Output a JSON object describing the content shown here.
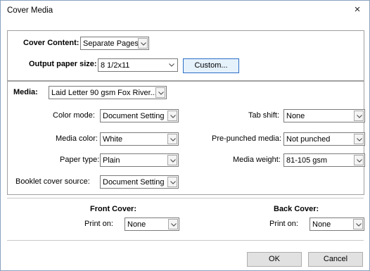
{
  "window": {
    "title": "Cover Media",
    "close_glyph": "×"
  },
  "cover": {
    "content_label": "Cover Content:",
    "content_value": "Separate Pages",
    "output_size_label": "Output paper size:",
    "output_size_value": "8 1/2x11",
    "custom_button": "Custom..."
  },
  "media": {
    "label": "Media:",
    "value": "Laid Letter 90 gsm Fox River...",
    "color_mode_label": "Color mode:",
    "color_mode_value": "Document Setting",
    "media_color_label": "Media color:",
    "media_color_value": "White",
    "paper_type_label": "Paper type:",
    "paper_type_value": "Plain",
    "booklet_label": "Booklet cover source:",
    "booklet_value": "Document Setting",
    "tab_shift_label": "Tab shift:",
    "tab_shift_value": "None",
    "prepunched_label": "Pre-punched media:",
    "prepunched_value": "Not punched",
    "weight_label": "Media weight:",
    "weight_value": "81-105 gsm"
  },
  "front": {
    "heading": "Front Cover:",
    "print_on_label": "Print on:",
    "print_on_value": "None"
  },
  "back": {
    "heading": "Back Cover:",
    "print_on_label": "Print on:",
    "print_on_value": "None"
  },
  "buttons": {
    "ok": "OK",
    "cancel": "Cancel"
  },
  "icons": {
    "close": "close-icon",
    "dropdown": "chevron-down-icon"
  }
}
